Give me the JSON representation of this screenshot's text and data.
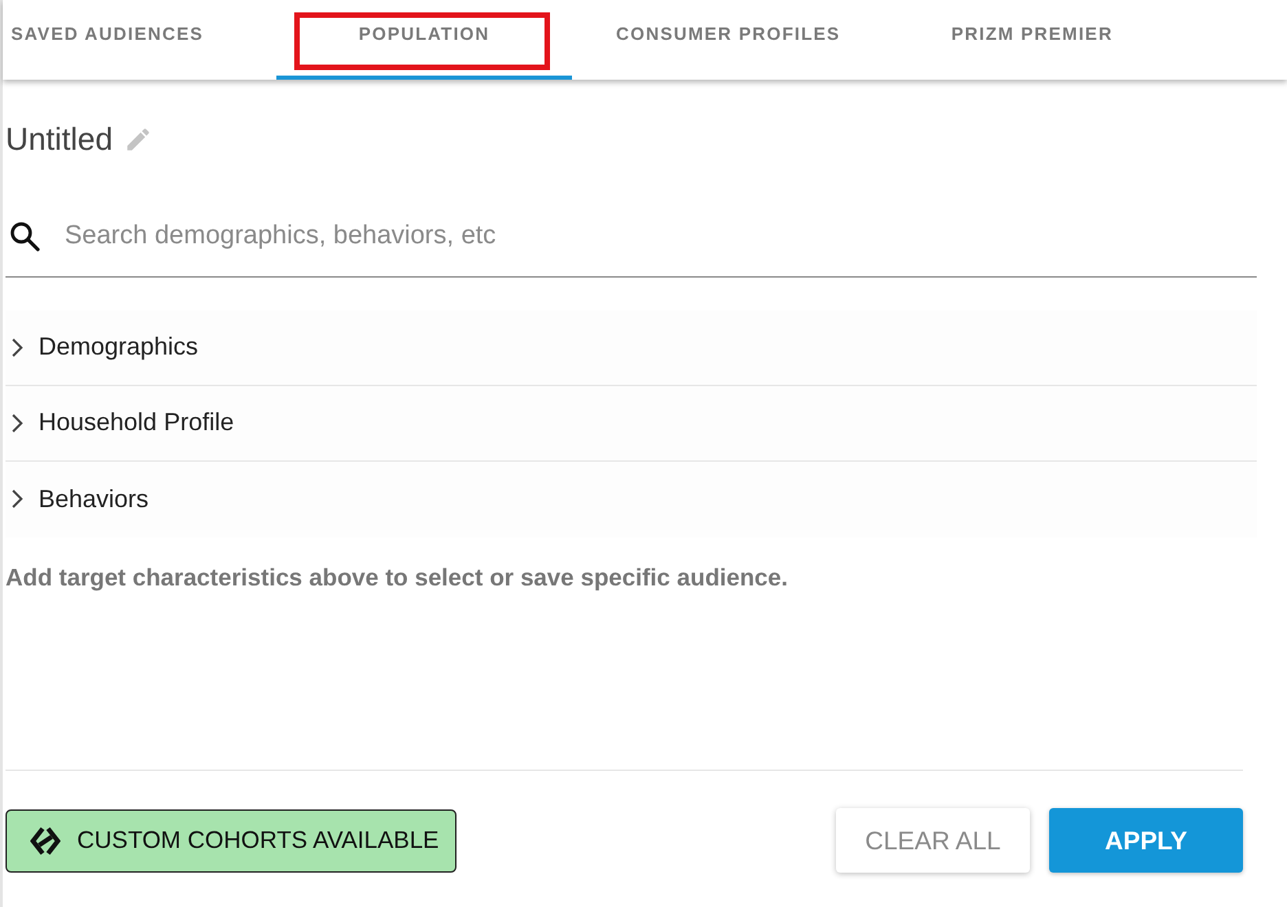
{
  "tabs": [
    {
      "label": "SAVED AUDIENCES",
      "selected": false,
      "highlighted": false
    },
    {
      "label": "POPULATION",
      "selected": true,
      "highlighted": true
    },
    {
      "label": "CONSUMER PROFILES",
      "selected": false,
      "highlighted": false
    },
    {
      "label": "PRIZM PREMIER",
      "selected": false,
      "highlighted": false
    }
  ],
  "audience": {
    "title": "Untitled"
  },
  "search": {
    "placeholder": "Search demographics, behaviors, etc"
  },
  "categories": [
    {
      "label": "Demographics",
      "expanded": false
    },
    {
      "label": "Household Profile",
      "expanded": false
    },
    {
      "label": "Behaviors",
      "expanded": false
    }
  ],
  "hint": "Add target characteristics above to select or save specific audience.",
  "footer": {
    "cohorts_button": "CUSTOM COHORTS AVAILABLE",
    "buttons": [
      {
        "label": "CLEAR ALL",
        "kind": "secondary"
      },
      {
        "label": "APPLY",
        "kind": "primary"
      }
    ]
  }
}
